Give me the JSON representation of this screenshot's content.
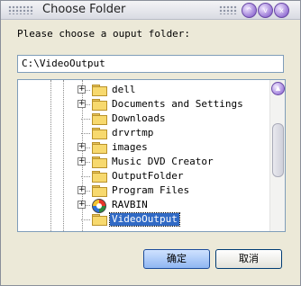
{
  "window": {
    "title": "Choose Folder",
    "title_buttons": [
      "^",
      "v",
      "x"
    ]
  },
  "prompt": "Please choose a ouput folder:",
  "path_input": {
    "value": "C:\\VideoOutput"
  },
  "tree": {
    "items": [
      {
        "label": "dell",
        "expandable": true,
        "icon": "folder-icon",
        "selected": false
      },
      {
        "label": "Documents and Settings",
        "expandable": true,
        "icon": "folder-icon",
        "selected": false
      },
      {
        "label": "Downloads",
        "expandable": false,
        "icon": "folder-icon",
        "selected": false
      },
      {
        "label": "drvrtmp",
        "expandable": false,
        "icon": "folder-icon",
        "selected": false
      },
      {
        "label": "images",
        "expandable": true,
        "icon": "folder-icon",
        "selected": false
      },
      {
        "label": "Music DVD Creator",
        "expandable": true,
        "icon": "folder-icon",
        "selected": false
      },
      {
        "label": "OutputFolder",
        "expandable": false,
        "icon": "folder-icon",
        "selected": false
      },
      {
        "label": "Program Files",
        "expandable": true,
        "icon": "folder-icon",
        "selected": false
      },
      {
        "label": "RAVBIN",
        "expandable": true,
        "icon": "disc-icon",
        "selected": false
      },
      {
        "label": "VideoOutput",
        "expandable": false,
        "icon": "folder-icon",
        "selected": true
      }
    ]
  },
  "buttons": {
    "ok": "确定",
    "cancel": "取消"
  }
}
